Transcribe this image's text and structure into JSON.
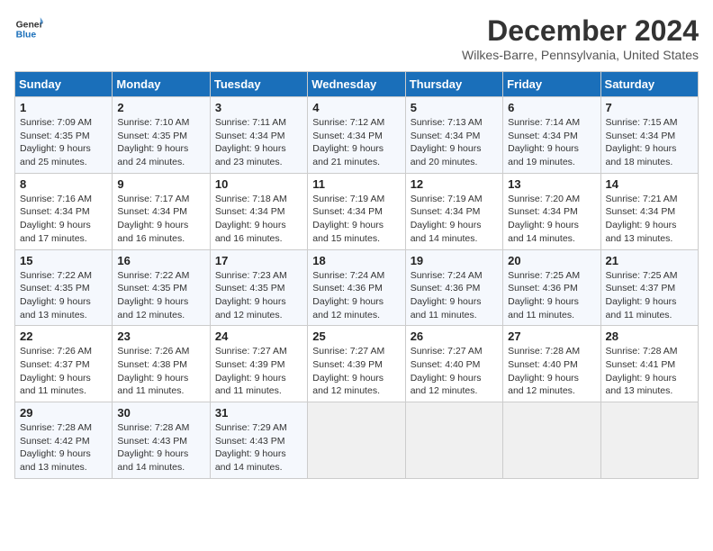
{
  "header": {
    "logo_line1": "General",
    "logo_line2": "Blue",
    "month_title": "December 2024",
    "location": "Wilkes-Barre, Pennsylvania, United States"
  },
  "weekdays": [
    "Sunday",
    "Monday",
    "Tuesday",
    "Wednesday",
    "Thursday",
    "Friday",
    "Saturday"
  ],
  "weeks": [
    [
      {
        "day": "1",
        "sunrise": "Sunrise: 7:09 AM",
        "sunset": "Sunset: 4:35 PM",
        "daylight": "Daylight: 9 hours and 25 minutes."
      },
      {
        "day": "2",
        "sunrise": "Sunrise: 7:10 AM",
        "sunset": "Sunset: 4:35 PM",
        "daylight": "Daylight: 9 hours and 24 minutes."
      },
      {
        "day": "3",
        "sunrise": "Sunrise: 7:11 AM",
        "sunset": "Sunset: 4:34 PM",
        "daylight": "Daylight: 9 hours and 23 minutes."
      },
      {
        "day": "4",
        "sunrise": "Sunrise: 7:12 AM",
        "sunset": "Sunset: 4:34 PM",
        "daylight": "Daylight: 9 hours and 21 minutes."
      },
      {
        "day": "5",
        "sunrise": "Sunrise: 7:13 AM",
        "sunset": "Sunset: 4:34 PM",
        "daylight": "Daylight: 9 hours and 20 minutes."
      },
      {
        "day": "6",
        "sunrise": "Sunrise: 7:14 AM",
        "sunset": "Sunset: 4:34 PM",
        "daylight": "Daylight: 9 hours and 19 minutes."
      },
      {
        "day": "7",
        "sunrise": "Sunrise: 7:15 AM",
        "sunset": "Sunset: 4:34 PM",
        "daylight": "Daylight: 9 hours and 18 minutes."
      }
    ],
    [
      {
        "day": "8",
        "sunrise": "Sunrise: 7:16 AM",
        "sunset": "Sunset: 4:34 PM",
        "daylight": "Daylight: 9 hours and 17 minutes."
      },
      {
        "day": "9",
        "sunrise": "Sunrise: 7:17 AM",
        "sunset": "Sunset: 4:34 PM",
        "daylight": "Daylight: 9 hours and 16 minutes."
      },
      {
        "day": "10",
        "sunrise": "Sunrise: 7:18 AM",
        "sunset": "Sunset: 4:34 PM",
        "daylight": "Daylight: 9 hours and 16 minutes."
      },
      {
        "day": "11",
        "sunrise": "Sunrise: 7:19 AM",
        "sunset": "Sunset: 4:34 PM",
        "daylight": "Daylight: 9 hours and 15 minutes."
      },
      {
        "day": "12",
        "sunrise": "Sunrise: 7:19 AM",
        "sunset": "Sunset: 4:34 PM",
        "daylight": "Daylight: 9 hours and 14 minutes."
      },
      {
        "day": "13",
        "sunrise": "Sunrise: 7:20 AM",
        "sunset": "Sunset: 4:34 PM",
        "daylight": "Daylight: 9 hours and 14 minutes."
      },
      {
        "day": "14",
        "sunrise": "Sunrise: 7:21 AM",
        "sunset": "Sunset: 4:34 PM",
        "daylight": "Daylight: 9 hours and 13 minutes."
      }
    ],
    [
      {
        "day": "15",
        "sunrise": "Sunrise: 7:22 AM",
        "sunset": "Sunset: 4:35 PM",
        "daylight": "Daylight: 9 hours and 13 minutes."
      },
      {
        "day": "16",
        "sunrise": "Sunrise: 7:22 AM",
        "sunset": "Sunset: 4:35 PM",
        "daylight": "Daylight: 9 hours and 12 minutes."
      },
      {
        "day": "17",
        "sunrise": "Sunrise: 7:23 AM",
        "sunset": "Sunset: 4:35 PM",
        "daylight": "Daylight: 9 hours and 12 minutes."
      },
      {
        "day": "18",
        "sunrise": "Sunrise: 7:24 AM",
        "sunset": "Sunset: 4:36 PM",
        "daylight": "Daylight: 9 hours and 12 minutes."
      },
      {
        "day": "19",
        "sunrise": "Sunrise: 7:24 AM",
        "sunset": "Sunset: 4:36 PM",
        "daylight": "Daylight: 9 hours and 11 minutes."
      },
      {
        "day": "20",
        "sunrise": "Sunrise: 7:25 AM",
        "sunset": "Sunset: 4:36 PM",
        "daylight": "Daylight: 9 hours and 11 minutes."
      },
      {
        "day": "21",
        "sunrise": "Sunrise: 7:25 AM",
        "sunset": "Sunset: 4:37 PM",
        "daylight": "Daylight: 9 hours and 11 minutes."
      }
    ],
    [
      {
        "day": "22",
        "sunrise": "Sunrise: 7:26 AM",
        "sunset": "Sunset: 4:37 PM",
        "daylight": "Daylight: 9 hours and 11 minutes."
      },
      {
        "day": "23",
        "sunrise": "Sunrise: 7:26 AM",
        "sunset": "Sunset: 4:38 PM",
        "daylight": "Daylight: 9 hours and 11 minutes."
      },
      {
        "day": "24",
        "sunrise": "Sunrise: 7:27 AM",
        "sunset": "Sunset: 4:39 PM",
        "daylight": "Daylight: 9 hours and 11 minutes."
      },
      {
        "day": "25",
        "sunrise": "Sunrise: 7:27 AM",
        "sunset": "Sunset: 4:39 PM",
        "daylight": "Daylight: 9 hours and 12 minutes."
      },
      {
        "day": "26",
        "sunrise": "Sunrise: 7:27 AM",
        "sunset": "Sunset: 4:40 PM",
        "daylight": "Daylight: 9 hours and 12 minutes."
      },
      {
        "day": "27",
        "sunrise": "Sunrise: 7:28 AM",
        "sunset": "Sunset: 4:40 PM",
        "daylight": "Daylight: 9 hours and 12 minutes."
      },
      {
        "day": "28",
        "sunrise": "Sunrise: 7:28 AM",
        "sunset": "Sunset: 4:41 PM",
        "daylight": "Daylight: 9 hours and 13 minutes."
      }
    ],
    [
      {
        "day": "29",
        "sunrise": "Sunrise: 7:28 AM",
        "sunset": "Sunset: 4:42 PM",
        "daylight": "Daylight: 9 hours and 13 minutes."
      },
      {
        "day": "30",
        "sunrise": "Sunrise: 7:28 AM",
        "sunset": "Sunset: 4:43 PM",
        "daylight": "Daylight: 9 hours and 14 minutes."
      },
      {
        "day": "31",
        "sunrise": "Sunrise: 7:29 AM",
        "sunset": "Sunset: 4:43 PM",
        "daylight": "Daylight: 9 hours and 14 minutes."
      },
      null,
      null,
      null,
      null
    ]
  ]
}
